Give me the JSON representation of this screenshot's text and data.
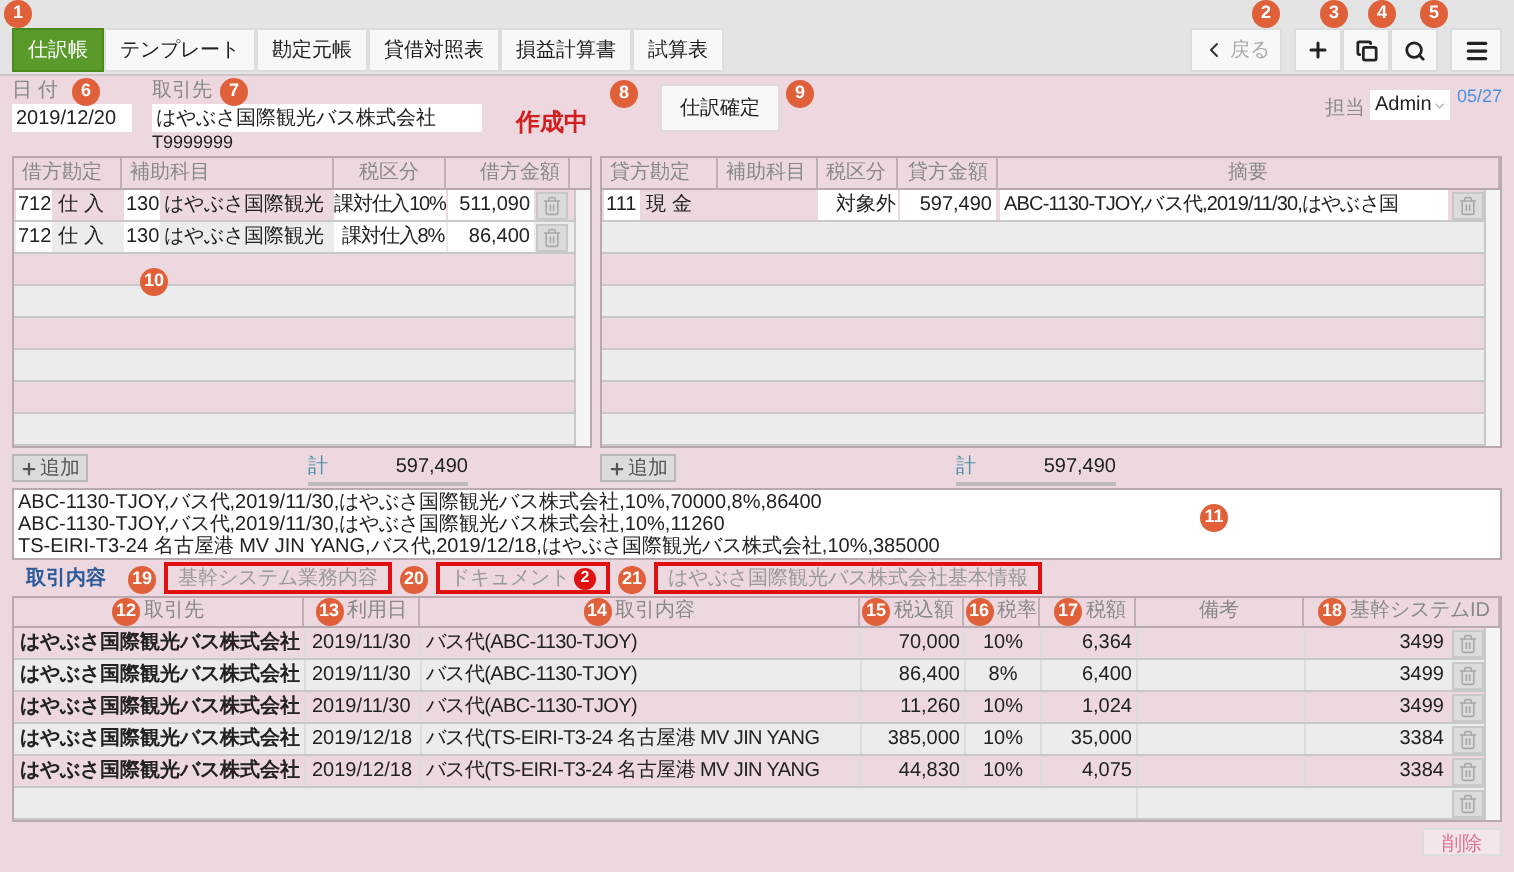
{
  "toolbar": {
    "tabs": [
      {
        "label": "仕訳帳",
        "selected": true
      },
      {
        "label": "テンプレート",
        "selected": false
      },
      {
        "label": "勘定元帳",
        "selected": false
      },
      {
        "label": "貸借対照表",
        "selected": false
      },
      {
        "label": "損益計算書",
        "selected": false
      },
      {
        "label": "試算表",
        "selected": false
      }
    ],
    "back_button": "戻る"
  },
  "entry": {
    "date_label": "日 付",
    "date": "2019/12/20",
    "partner_label": "取引先",
    "partner": "はやぶさ国際観光バス株式会社",
    "registration": "T9999999",
    "status": "作成中",
    "confirm_button": "仕訳確定",
    "staff_label": "担当",
    "staff": "Admin",
    "count": "05/27"
  },
  "debit_table": {
    "columns": [
      "借方勘定",
      "補助科目",
      "税区分",
      "借方金額"
    ],
    "rows": [
      {
        "code": "712",
        "account": "仕 入",
        "sub_code": "130",
        "sub_account": "はやぶさ国際観光",
        "tax": "課対仕入10%",
        "amount": "511,090"
      },
      {
        "code": "712",
        "account": "仕 入",
        "sub_code": "130",
        "sub_account": "はやぶさ国際観光",
        "tax": "課対仕入8%",
        "amount": "86,400"
      }
    ],
    "add_button": "追加",
    "total_label": "計",
    "total": "597,490"
  },
  "credit_table": {
    "columns": [
      "貸方勘定",
      "補助科目",
      "税区分",
      "貸方金額",
      "摘要"
    ],
    "rows": [
      {
        "code": "111",
        "account": "現 金",
        "tax": "対象外",
        "amount": "597,490",
        "memo": "ABC-1130-TJOY,バス代,2019/11/30,はやぶさ国"
      }
    ],
    "add_button": "追加",
    "total_label": "計",
    "total": "597,490"
  },
  "memo_lines": [
    "ABC-1130-TJOY,バス代,2019/11/30,はやぶさ国際観光バス株式会社,10%,70000,8%,86400",
    "ABC-1130-TJOY,バス代,2019/11/30,はやぶさ国際観光バス株式会社,10%,11260",
    "TS-EIRI-T3-24 名古屋港 MV JIN YANG,バス代,2019/12/18,はやぶさ国際観光バス株式会社,10%,385000"
  ],
  "detail_tabs": [
    {
      "label": "取引内容",
      "selected": true,
      "highlighted": false
    },
    {
      "label": "基幹システム業務内容",
      "selected": false,
      "highlighted": true
    },
    {
      "label": "ドキュメント",
      "selected": false,
      "highlighted": true,
      "badge": "2"
    },
    {
      "label": "はやぶさ国際観光バス株式会社基本情報",
      "selected": false,
      "highlighted": true
    }
  ],
  "detail_table": {
    "columns": [
      "取引先",
      "利用日",
      "取引内容",
      "税込額",
      "税率",
      "税額",
      "備考",
      "基幹システムID"
    ],
    "rows": [
      {
        "partner": "はやぶさ国際観光バス株式会社",
        "date": "2019/11/30",
        "content": "バス代(ABC-1130-TJOY)",
        "gross": "70,000",
        "rate": "10%",
        "tax": "6,364",
        "id": "3499"
      },
      {
        "partner": "はやぶさ国際観光バス株式会社",
        "date": "2019/11/30",
        "content": "バス代(ABC-1130-TJOY)",
        "gross": "86,400",
        "rate": "8%",
        "tax": "6,400",
        "id": "3499"
      },
      {
        "partner": "はやぶさ国際観光バス株式会社",
        "date": "2019/11/30",
        "content": "バス代(ABC-1130-TJOY)",
        "gross": "11,260",
        "rate": "10%",
        "tax": "1,024",
        "id": "3499"
      },
      {
        "partner": "はやぶさ国際観光バス株式会社",
        "date": "2019/12/18",
        "content": "バス代(TS-EIRI-T3-24 名古屋港 MV JIN YANG",
        "gross": "385,000",
        "rate": "10%",
        "tax": "35,000",
        "id": "3384"
      },
      {
        "partner": "はやぶさ国際観光バス株式会社",
        "date": "2019/12/18",
        "content": "バス代(TS-EIRI-T3-24 名古屋港 MV JIN YANG",
        "gross": "44,830",
        "rate": "10%",
        "tax": "4,075",
        "id": "3384"
      }
    ]
  },
  "delete_button": "削除",
  "callouts": [
    "1",
    "2",
    "3",
    "4",
    "5",
    "6",
    "7",
    "8",
    "9",
    "10",
    "11",
    "12",
    "13",
    "14",
    "15",
    "16",
    "17",
    "18",
    "19",
    "20",
    "21"
  ]
}
